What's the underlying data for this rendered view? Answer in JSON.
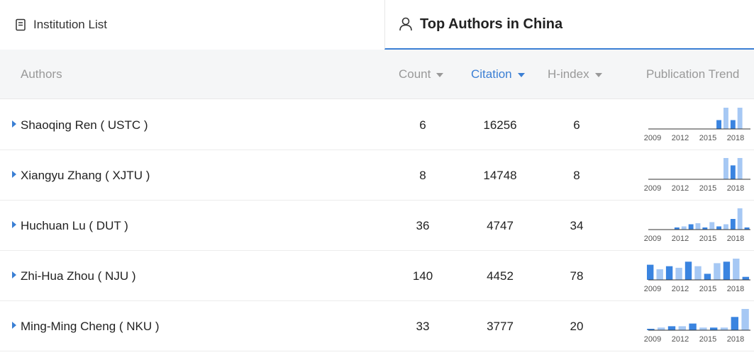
{
  "tabs": {
    "institution_list": "Institution List",
    "top_authors": "Top Authors in China"
  },
  "table": {
    "headers": {
      "authors": "Authors",
      "count": "Count",
      "citation": "Citation",
      "hindex": "H-index",
      "trend": "Publication Trend"
    },
    "sort_active": "citation",
    "rows": [
      {
        "author": "Shaoqing Ren ( USTC )",
        "count": "6",
        "citation": "16256",
        "hindex": "6",
        "trend": [
          0,
          0,
          0,
          0,
          0,
          0,
          0,
          0,
          0,
          0,
          1,
          2.4,
          1,
          2.4,
          0
        ]
      },
      {
        "author": "Xiangyu Zhang ( XJTU )",
        "count": "8",
        "citation": "14748",
        "hindex": "8",
        "trend": [
          0,
          0,
          0,
          0,
          0,
          0,
          0,
          0,
          0,
          0,
          0,
          2.6,
          1.7,
          2.6,
          0
        ]
      },
      {
        "author": "Huchuan Lu ( DUT )",
        "count": "36",
        "citation": "4747",
        "hindex": "34",
        "trend": [
          0,
          0,
          0,
          0,
          0.2,
          0.3,
          0.5,
          0.6,
          0.2,
          0.7,
          0.3,
          0.5,
          1,
          2,
          0.2
        ]
      },
      {
        "author": "Zhi-Hua Zhou ( NJU )",
        "count": "140",
        "citation": "4452",
        "hindex": "78",
        "trend": [
          1,
          0.7,
          0.9,
          0.8,
          1.2,
          0.9,
          0.4,
          1.1,
          1.2,
          1.4,
          0.2
        ]
      },
      {
        "author": "Ming-Ming Cheng ( NKU )",
        "count": "33",
        "citation": "3777",
        "hindex": "20",
        "trend": [
          0.1,
          0.2,
          0.3,
          0.3,
          0.5,
          0.2,
          0.2,
          0.2,
          1,
          1.6
        ]
      }
    ]
  },
  "trend_axis_labels": [
    "2009",
    "2012",
    "2015",
    "2018"
  ],
  "colors": {
    "accent": "#3b7fd4",
    "bar_dark": "#3a84e0",
    "bar_light": "#a6c8f4"
  },
  "icons": {
    "institution_tab": "document-icon",
    "authors_tab": "person-icon",
    "expand": "caret-right-icon"
  }
}
